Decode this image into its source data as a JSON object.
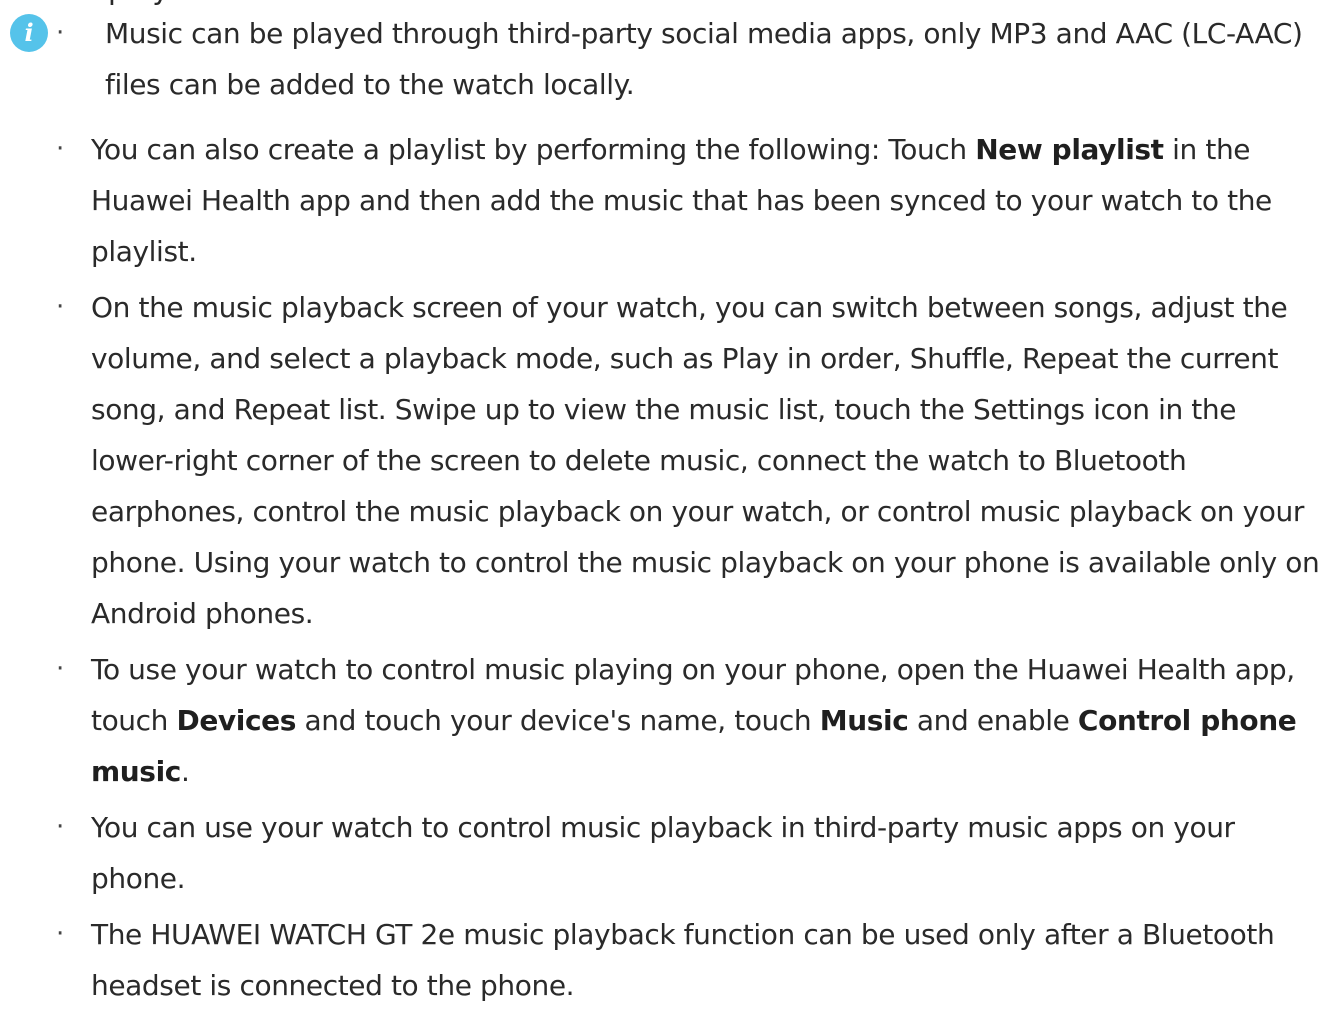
{
  "top_clipped_text": "playl",
  "icon": {
    "name": "info-icon",
    "glyph": "i",
    "color": "#55c3ea"
  },
  "bullet_glyph": "·",
  "items": [
    {
      "text": "Music can be played through third-party social media apps, only MP3 and AAC (LC-AAC) files can be added to the watch locally."
    },
    {
      "pre": "You can also create a playlist by performing the following: Touch ",
      "bold1": "New playlist",
      "post": " in the Huawei Health app and then add the music that has been synced to your watch to the playlist."
    },
    {
      "text": "On the music playback screen of your watch, you can switch between songs, adjust the volume, and select a playback mode, such as Play in order, Shuffle, Repeat the current song, and Repeat list. Swipe up to view the music list, touch the Settings icon in the lower-right corner of the screen to delete music, connect the watch to Bluetooth earphones, control the music playback on your watch, or control music playback on your phone. Using your watch to control the music playback on your phone is available only on Android phones."
    },
    {
      "pre": "To use your watch to control music playing on your phone, open the Huawei Health app, touch ",
      "bold1": "Devices",
      "mid1": " and touch your device's name, touch ",
      "bold2": "Music",
      "mid2": " and enable ",
      "bold3": "Control phone music",
      "post": "."
    },
    {
      "text": "You can use your watch to control music playback in third-party music apps on your phone."
    },
    {
      "text": "The HUAWEI WATCH GT 2e music playback function can be used only after a Bluetooth headset is connected to the phone."
    }
  ]
}
